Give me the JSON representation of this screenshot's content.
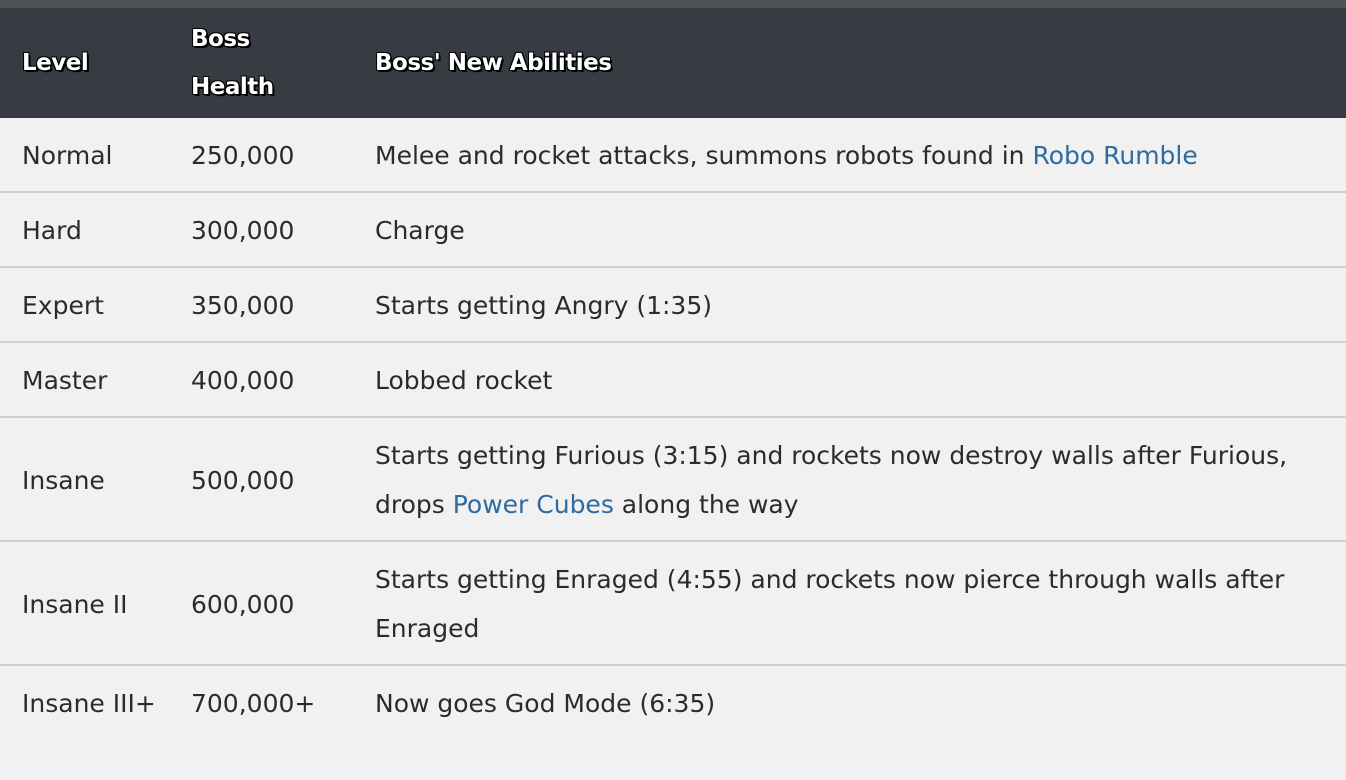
{
  "table": {
    "headers": {
      "level_line1": "Level",
      "health_line1": "Boss",
      "health_line2": "Health",
      "abilities": "Boss' New Abilities"
    },
    "rows": [
      {
        "level": "Normal",
        "health": "250,000",
        "abilities_pre": "Melee and rocket attacks, summons robots found in ",
        "abilities_link": "Robo Rumble",
        "abilities_post": ""
      },
      {
        "level": "Hard",
        "health": "300,000",
        "abilities_pre": "Charge",
        "abilities_link": "",
        "abilities_post": ""
      },
      {
        "level": "Expert",
        "health": "350,000",
        "abilities_pre": "Starts getting Angry (1:35)",
        "abilities_link": "",
        "abilities_post": ""
      },
      {
        "level": "Master",
        "health": "400,000",
        "abilities_pre": "Lobbed rocket",
        "abilities_link": "",
        "abilities_post": ""
      },
      {
        "level": "Insane",
        "health": "500,000",
        "abilities_pre": "Starts getting Furious (3:15) and rockets now destroy walls after Furious, drops ",
        "abilities_link": "Power Cubes",
        "abilities_post": " along the way"
      },
      {
        "level": "Insane II",
        "health": "600,000",
        "abilities_pre": "Starts getting Enraged (4:55) and rockets now pierce through walls after Enraged",
        "abilities_link": "",
        "abilities_post": ""
      },
      {
        "level": "Insane III+",
        "health": "700,000+",
        "abilities_pre": "Now goes God Mode (6:35)",
        "abilities_link": "",
        "abilities_post": ""
      }
    ]
  },
  "colors": {
    "header_bg": "#373b42",
    "row_bg": "#f1f1f1",
    "link": "#2f6aa1",
    "divider": "#cfcfcf"
  }
}
